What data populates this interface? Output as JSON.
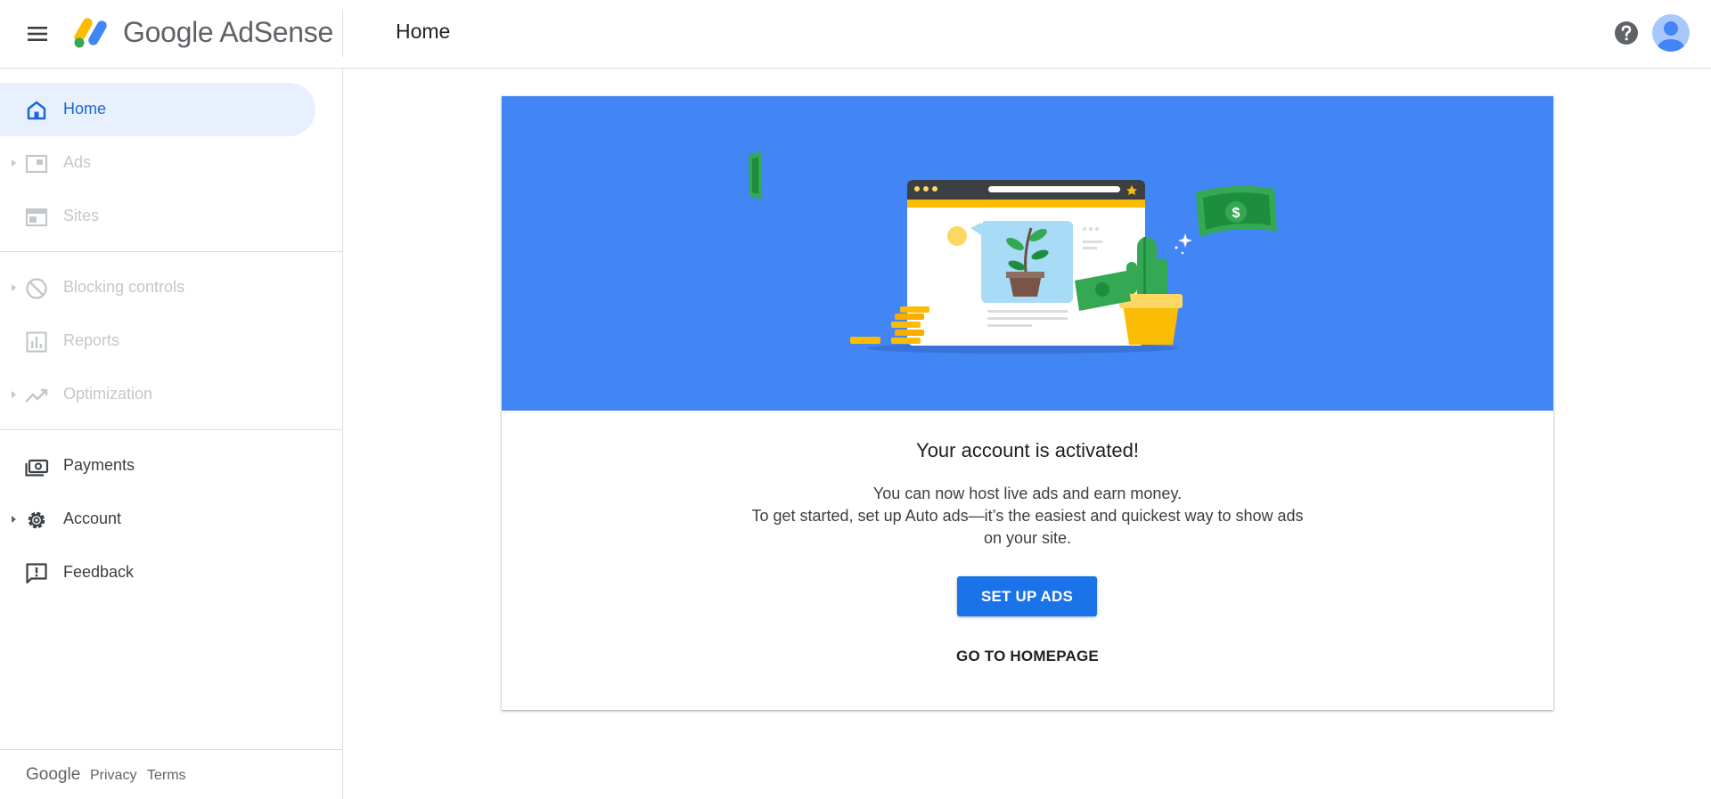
{
  "header": {
    "product_name": "Google AdSense",
    "page_title": "Home",
    "icons": {
      "menu": "menu-icon",
      "help": "help-icon",
      "avatar": "account-avatar"
    }
  },
  "sidebar": {
    "items": [
      {
        "label": "Home",
        "icon": "home-icon",
        "state": "active"
      },
      {
        "label": "Ads",
        "icon": "ads-icon",
        "state": "disabled",
        "expandable": true
      },
      {
        "label": "Sites",
        "icon": "sites-icon",
        "state": "disabled"
      },
      {
        "label": "Blocking controls",
        "icon": "block-icon",
        "state": "disabled",
        "expandable": true
      },
      {
        "label": "Reports",
        "icon": "bar-chart-icon",
        "state": "disabled"
      },
      {
        "label": "Optimization",
        "icon": "trending-up-icon",
        "state": "disabled",
        "expandable": true
      },
      {
        "label": "Payments",
        "icon": "payments-icon",
        "state": "enabled"
      },
      {
        "label": "Account",
        "icon": "gear-icon",
        "state": "enabled",
        "expandable": true
      },
      {
        "label": "Feedback",
        "icon": "feedback-icon",
        "state": "enabled"
      }
    ],
    "footer": {
      "brand": "Google",
      "privacy": "Privacy",
      "terms": "Terms"
    }
  },
  "card": {
    "title": "Your account is activated!",
    "body_line1": "You can now host live ads and earn money.",
    "body_line2": "To get started, set up Auto ads—it’s the easiest and quickest way to show ads",
    "body_line3": "on your site.",
    "primary_button": "SET UP ADS",
    "secondary_button": "GO TO HOMEPAGE"
  },
  "colors": {
    "accent": "#1a73e8",
    "hero_background": "#4285f4",
    "active_nav_bg": "#e8f0fe",
    "active_nav_text": "#1967d2",
    "disabled_text": "#c4c7cb"
  }
}
